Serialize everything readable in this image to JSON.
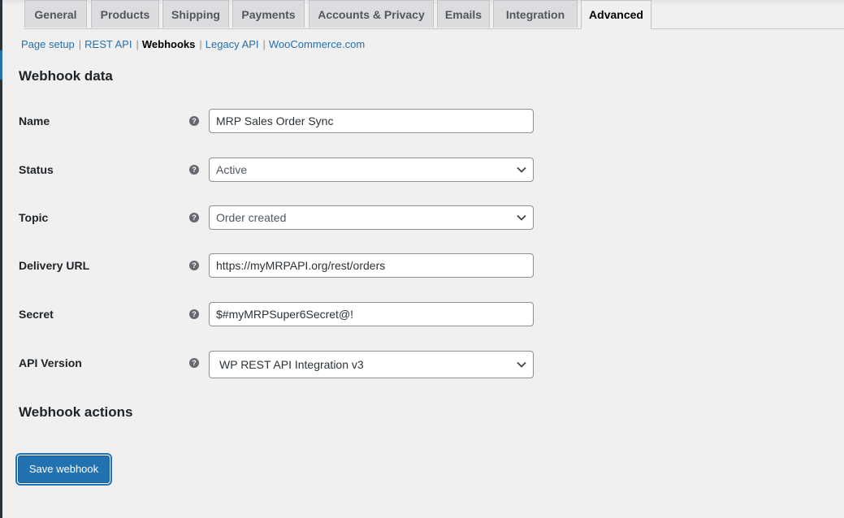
{
  "tabs": [
    {
      "label": "General"
    },
    {
      "label": "Products"
    },
    {
      "label": "Shipping"
    },
    {
      "label": "Payments"
    },
    {
      "label": "Accounts & Privacy"
    },
    {
      "label": "Emails"
    },
    {
      "label": "Integration"
    },
    {
      "label": "Advanced",
      "active": true
    }
  ],
  "subnav": [
    {
      "label": "Page setup"
    },
    {
      "label": "REST API"
    },
    {
      "label": "Webhooks",
      "current": true
    },
    {
      "label": "Legacy API"
    },
    {
      "label": "WooCommerce.com"
    }
  ],
  "subnav_separator": "|",
  "section_title": "Webhook data",
  "fields": {
    "name": {
      "label": "Name",
      "value": "MRP Sales Order Sync"
    },
    "status": {
      "label": "Status",
      "value": "Active"
    },
    "topic": {
      "label": "Topic",
      "value": "Order created"
    },
    "delivery_url": {
      "label": "Delivery URL",
      "value": "https://myMRPAPI.org/rest/orders"
    },
    "secret": {
      "label": "Secret",
      "value": "$#myMRPSuper6Secret@!"
    },
    "api_version": {
      "label": "API Version",
      "value": "WP REST API Integration v3"
    }
  },
  "help_icon": "?",
  "actions_title": "Webhook actions",
  "save_button": "Save webhook",
  "colors": {
    "accent": "#2271b1",
    "background": "#f0f0f1",
    "admin_bar": "#2c3338"
  }
}
